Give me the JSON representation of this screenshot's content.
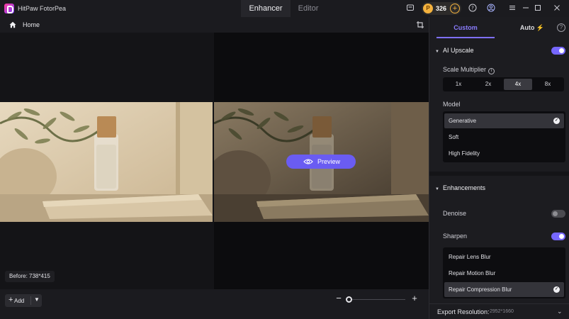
{
  "app": {
    "title": "HitPaw FotorPea"
  },
  "mode_tabs": [
    {
      "label": "Enhancer",
      "active": true
    },
    {
      "label": "Editor",
      "active": false
    }
  ],
  "titlebar": {
    "credits": "326",
    "icons": [
      "message-icon",
      "coin-icon",
      "add-credits-icon",
      "help-icon",
      "account-icon",
      "menu-icon",
      "minimize-icon",
      "maximize-icon",
      "close-icon"
    ]
  },
  "toolbar": {
    "home_label": "Home"
  },
  "canvas": {
    "preview_label": "Preview",
    "before_badge": "Before: 738*415"
  },
  "bottombar": {
    "add_label": "Add"
  },
  "panel": {
    "tabs": [
      {
        "label": "Custom",
        "active": true
      },
      {
        "label": "Auto",
        "active": false
      }
    ],
    "ai_upscale": {
      "title": "AI Upscale",
      "enabled": true,
      "scale_label": "Scale Multiplier",
      "scales": [
        "1x",
        "2x",
        "4x",
        "8x"
      ],
      "selected_scale": "4x",
      "model_label": "Model",
      "models": [
        "Generative",
        "Soft",
        "High Fidelity"
      ],
      "selected_model": "Generative"
    },
    "enhancements": {
      "title": "Enhancements",
      "denoise_label": "Denoise",
      "denoise_enabled": false,
      "sharpen_label": "Sharpen",
      "sharpen_enabled": true,
      "sharpen_options": [
        "Repair Lens Blur",
        "Repair Motion Blur",
        "Repair Compression Blur"
      ],
      "selected_sharpen": "Repair Compression Blur"
    },
    "export": {
      "label": "Export Resolution:",
      "value": "2952*1660"
    }
  },
  "colors": {
    "accent": "#7667ff",
    "preview_button": "#6a5cf2",
    "coin": "#f4b23e",
    "background": "#121215",
    "panel": "#1c1c20"
  }
}
